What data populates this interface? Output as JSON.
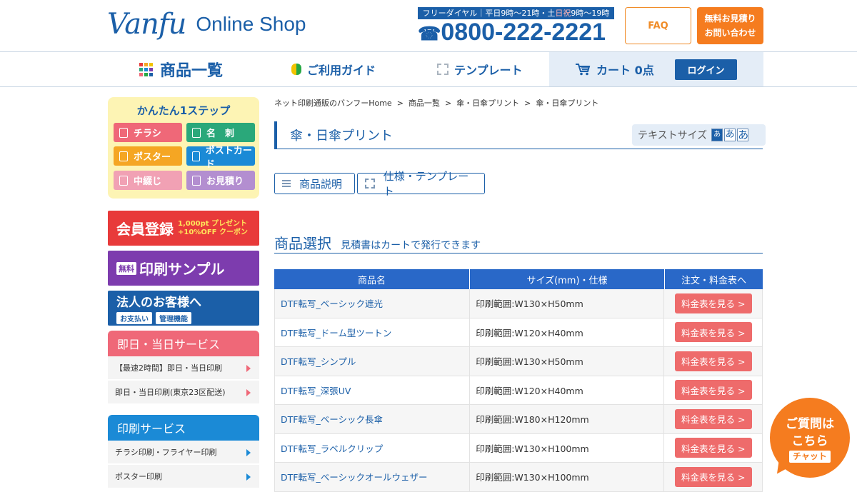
{
  "header": {
    "logo_mark": "Vanfu",
    "logo_text": "Online Shop",
    "phone_label_a": "フリーダイヤル｜平日9時～21時・土",
    "phone_label_hol": "日祝",
    "phone_label_b": "9時～19時",
    "phone_icon": "☎",
    "phone_number": "0800-222-2221",
    "faq": "FAQ",
    "quote_line1": "無料お見積り",
    "quote_line2": "お問い合わせ"
  },
  "nav": {
    "products": "商品一覧",
    "guide": "ご利用ガイド",
    "template": "テンプレート",
    "cart": "カート 0点",
    "login": "ログイン"
  },
  "sidebar": {
    "step_title": "かんたん1ステップ",
    "steps": [
      {
        "label": "チラシ",
        "color": "#ef6878"
      },
      {
        "label": "名　刺",
        "color": "#2aa87a"
      },
      {
        "label": "ポスター",
        "color": "#f5a623"
      },
      {
        "label": "ポストカード",
        "color": "#1b8ad6"
      },
      {
        "label": "中綴じ",
        "color": "#f1a1b4"
      },
      {
        "label": "お見積り",
        "color": "#b38ed0"
      }
    ],
    "banner_member": "会員登録",
    "banner_member_small1": "1,000pt プレゼント",
    "banner_member_small2": "+10%OFF クーポン",
    "banner_sample_tag": "無料",
    "banner_sample": "印刷サンプル",
    "banner_corp": "法人のお客様へ",
    "banner_corp_chip1": "お支払い",
    "banner_corp_chip2": "管理機能",
    "sameday_head": "即日・当日サービス",
    "sameday_items": [
      "【最速2時間】即日・当日印刷",
      "即日・当日印刷(東京23区配送)"
    ],
    "print_head": "印刷サービス",
    "print_items": [
      "チラシ印刷・フライヤー印刷",
      "ポスター印刷"
    ]
  },
  "main": {
    "breadcrumb": [
      "ネット印刷通販のバンフーHome",
      "商品一覧",
      "傘・日傘プリント",
      "傘・日傘プリント"
    ],
    "breadcrumb_sep": ">",
    "title": "傘・日傘プリント",
    "textsize_label": "テキストサイズ",
    "textsize_s": "あ",
    "textsize_m": "あ",
    "textsize_l": "あ",
    "tab_desc": "商品説明",
    "tab_spec": "仕様・テンプレート",
    "section_title": "商品選択",
    "section_sub": "見積書はカートで発行できます"
  },
  "table": {
    "headers": [
      "商品名",
      "サイズ(mm)・仕様",
      "注文・料金表へ"
    ],
    "button_label": "料金表を見る >",
    "rows": [
      {
        "name": "DTF転写_ベーシック遮光",
        "size": "印刷範囲:W130×H50mm"
      },
      {
        "name": "DTF転写_ドーム型ツートン",
        "size": "印刷範囲:W120×H40mm"
      },
      {
        "name": "DTF転写_シンプル",
        "size": "印刷範囲:W130×H50mm"
      },
      {
        "name": "DTF転写_深張UV",
        "size": "印刷範囲:W120×H40mm"
      },
      {
        "name": "DTF転写_ベーシック長傘",
        "size": "印刷範囲:W180×H120mm"
      },
      {
        "name": "DTF転写_ラベルクリップ",
        "size": "印刷範囲:W130×H100mm"
      },
      {
        "name": "DTF転写_ベーシックオールウェザー",
        "size": "印刷範囲:W130×H100mm"
      }
    ]
  },
  "chat": {
    "line1": "ご質問は",
    "line2": "こちら",
    "line3": "チャット"
  },
  "colors": {
    "brand_blue": "#1b5fa8",
    "accent_orange": "#f57c1f",
    "button_red": "#ee6b6b"
  }
}
